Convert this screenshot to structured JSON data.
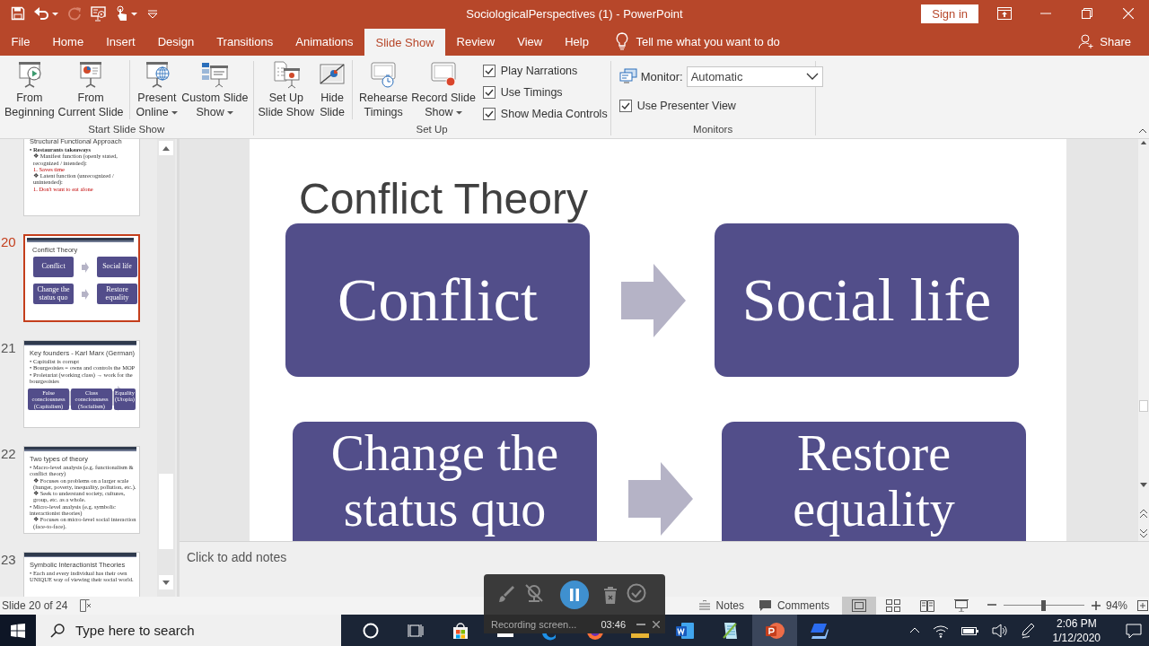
{
  "window": {
    "title": "SociologicalPerspectives (1)  -  PowerPoint",
    "sign_in": "Sign in"
  },
  "tabs": [
    {
      "label": "File",
      "selected": false
    },
    {
      "label": "Home",
      "selected": false
    },
    {
      "label": "Insert",
      "selected": false
    },
    {
      "label": "Design",
      "selected": false
    },
    {
      "label": "Transitions",
      "selected": false
    },
    {
      "label": "Animations",
      "selected": false
    },
    {
      "label": "Slide Show",
      "selected": true
    },
    {
      "label": "Review",
      "selected": false
    },
    {
      "label": "View",
      "selected": false
    },
    {
      "label": "Help",
      "selected": false
    }
  ],
  "tell_me": {
    "placeholder": "Tell me what you want to do"
  },
  "share": "Share",
  "ribbon": {
    "groups": [
      {
        "label": "Start Slide Show",
        "items": [
          {
            "kind": "button",
            "label": [
              "From",
              "Beginning"
            ],
            "menu": false,
            "separator": false
          },
          {
            "kind": "button",
            "label": [
              "From",
              "Current Slide"
            ],
            "menu": false,
            "separator": false
          },
          {
            "kind": "button",
            "label": [
              "Present",
              "Online"
            ],
            "menu": true,
            "separator": true
          },
          {
            "kind": "button",
            "label": [
              "Custom Slide",
              "Show"
            ],
            "menu": true,
            "separator": false
          }
        ]
      },
      {
        "label": "Set Up",
        "items": [
          {
            "kind": "button",
            "label": [
              "Set Up",
              "Slide Show"
            ],
            "menu": false,
            "separator": false
          },
          {
            "kind": "button",
            "label": [
              "Hide",
              "Slide"
            ],
            "menu": false,
            "separator": false
          },
          {
            "kind": "button",
            "label": [
              "Rehearse",
              "Timings"
            ],
            "menu": false,
            "separator": true
          },
          {
            "kind": "button",
            "label": [
              "Record Slide",
              "Show"
            ],
            "menu": true,
            "separator": false
          },
          {
            "kind": "checkbox",
            "label": "Play Narrations",
            "checked": true
          },
          {
            "kind": "checkbox",
            "label": "Use Timings",
            "checked": true
          },
          {
            "kind": "checkbox",
            "label": "Show Media Controls",
            "checked": true
          }
        ]
      },
      {
        "label": "Monitors",
        "items": [
          {
            "kind": "dropdown",
            "label": "Monitor:",
            "value": "Automatic"
          },
          {
            "kind": "checkbox",
            "label": "Use Presenter View",
            "checked": true
          }
        ]
      }
    ]
  },
  "thumbnails": [
    {
      "selected": false,
      "title": "Structural Functional Approach",
      "lines": [
        {
          "kind": "heading",
          "text": "• Restaurants takeaways"
        },
        {
          "kind": "sub",
          "text": "❖ Manifest function (openly stated, recognized / intended):"
        },
        {
          "kind": "numbered",
          "text": "1. Saves time"
        },
        {
          "kind": "sub",
          "text": "❖ Latent function (unrecognized / unintended):"
        },
        {
          "kind": "numbered",
          "text": "1. Don't want to eat alone"
        }
      ]
    },
    {
      "number": "20",
      "selected": true,
      "title": "Conflict Theory",
      "diagram": {
        "kind": "grid",
        "boxes": [
          "Conflict",
          "Social life",
          "Change the status quo",
          "Restore equality"
        ]
      }
    },
    {
      "number": "21",
      "selected": false,
      "title": "Key founders - Karl Marx (German)",
      "lines": [
        {
          "kind": "bullet",
          "text": "• Capitalist is corrupt"
        },
        {
          "kind": "bullet",
          "text": "• Bourgeoisies = owns and controls the MOP"
        },
        {
          "kind": "bullet",
          "text": "• Proletariat (working class) → work for the bourgeoisies"
        }
      ],
      "diagram": {
        "kind": "chain",
        "boxes": [
          "False consciousness (Capitalism)",
          "Class consciousness (Socialism)",
          "Equality (Utopia)"
        ]
      }
    },
    {
      "number": "22",
      "selected": false,
      "title": "Two types of theory",
      "lines": [
        {
          "kind": "bullet",
          "text": "• Macro-level analysis (e.g. functionalism & conflict theory)"
        },
        {
          "kind": "sub",
          "text": "❖ Focuses on problems on a larger scale (hunger, poverty, inequality, pollution, etc.)."
        },
        {
          "kind": "sub",
          "text": "❖ Seek to understand society, cultures, group, etc. as a whole."
        },
        {
          "kind": "bullet",
          "text": "• Micro-level analysis (e.g. symbolic interactionist theories)"
        },
        {
          "kind": "sub",
          "text": "❖ Focuses on micro-level social interaction (face-to-face)."
        }
      ]
    },
    {
      "number": "23",
      "selected": false,
      "title": "Symbolic Interactionist Theories",
      "lines": [
        {
          "kind": "bullet",
          "text": "• Each and every individual has their own UNIQUE way of viewing their social world."
        }
      ]
    }
  ],
  "slide": {
    "title": "Conflict Theory",
    "rows": [
      {
        "left": "Conflict",
        "right": "Social life"
      },
      {
        "left": "Change the status quo",
        "right": "Restore equality"
      }
    ]
  },
  "notes": {
    "placeholder": "Click to add notes"
  },
  "status_bar": {
    "slide": "Slide 20 of 24",
    "notes": "Notes",
    "comments": "Comments",
    "views": [
      {
        "selected": true
      },
      {
        "selected": false
      },
      {
        "selected": false
      },
      {
        "selected": false
      }
    ],
    "zoom": {
      "level": 0.49,
      "reading": "94%"
    }
  },
  "recorder": {
    "status": "Recording screen...",
    "time": "03:46"
  },
  "taskbar": {
    "search": {
      "placeholder": "Type here to search"
    },
    "apps": [
      {
        "selected": false
      },
      {
        "selected": false
      },
      {
        "selected": false
      },
      {
        "selected": false
      },
      {
        "selected": false
      },
      {
        "selected": false
      },
      {
        "selected": false
      },
      {
        "selected": true
      },
      {
        "selected": false
      }
    ],
    "time": "2:06 PM",
    "date": "1/12/2020"
  }
}
